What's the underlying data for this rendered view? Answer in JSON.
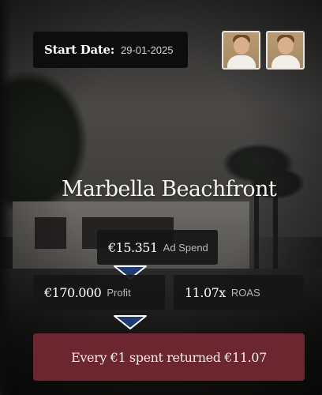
{
  "start": {
    "label": "Start Date:",
    "value": "29-01-2025"
  },
  "avatars": [
    {
      "icon": "person-avatar-icon"
    },
    {
      "icon": "person-avatar-icon"
    }
  ],
  "title": "Marbella Beachfront",
  "metrics": {
    "ad_spend": {
      "value": "€15.351",
      "label": "Ad Spend"
    },
    "profit": {
      "value": "€170.000",
      "label": "Profit"
    },
    "roas": {
      "value": "11.07x",
      "label": "ROAS"
    }
  },
  "summary": "Every €1 spent returned €11.07",
  "colors": {
    "summary_bg": "#6b2630",
    "arrow_fill": "#1f3b73",
    "arrow_stroke": "#ffffff"
  }
}
